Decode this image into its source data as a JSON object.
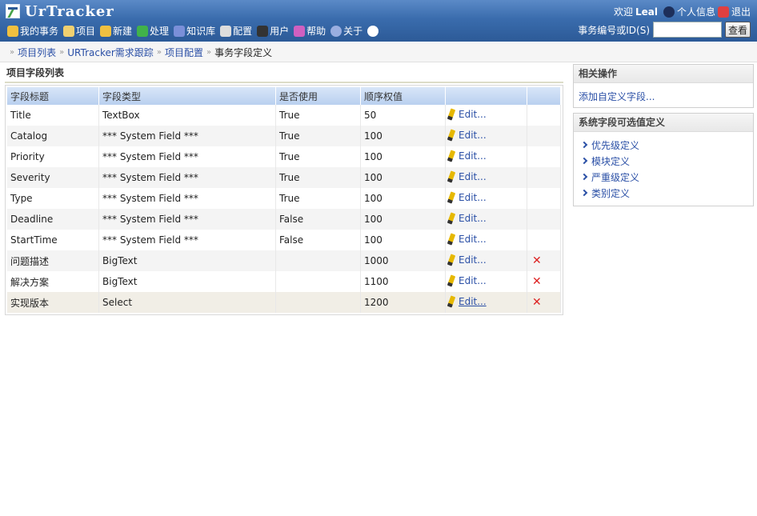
{
  "app": {
    "logo_text": "UrTracker"
  },
  "user": {
    "welcome": "欢迎",
    "name": "Leal",
    "profile_label": "个人信息",
    "logout_label": "退出"
  },
  "menu": [
    {
      "label": "我的事务",
      "icon": "home-icon",
      "color": "#f0c040"
    },
    {
      "label": "项目",
      "icon": "project-icon",
      "color": "#f0d070"
    },
    {
      "label": "新建",
      "icon": "new-icon",
      "color": "#f0c040"
    },
    {
      "label": "处理",
      "icon": "check-icon",
      "color": "#41b24a"
    },
    {
      "label": "知识库",
      "icon": "book-icon",
      "color": "#7a8fd8"
    },
    {
      "label": "配置",
      "icon": "config-icon",
      "color": "#dddddd"
    },
    {
      "label": "用户",
      "icon": "user-icon",
      "color": "#333333"
    },
    {
      "label": "帮助",
      "icon": "help-icon",
      "color": "#d060c0"
    },
    {
      "label": "关于",
      "icon": "about-icon",
      "color": "#9aaee0"
    },
    {
      "label": "",
      "icon": "info-icon",
      "color": "#ffffff"
    }
  ],
  "search": {
    "label": "事务编号或ID(S)",
    "value": "",
    "button": "查看"
  },
  "breadcrumb": [
    {
      "label": "项目列表",
      "link": true
    },
    {
      "label": "URTracker需求跟踪",
      "link": true
    },
    {
      "label": "项目配置",
      "link": true
    },
    {
      "label": "事务字段定义",
      "link": false
    }
  ],
  "main": {
    "title": "项目字段列表",
    "columns": [
      "字段标题",
      "字段类型",
      "是否使用",
      "顺序权值",
      "",
      ""
    ],
    "rows": [
      {
        "title": "Title",
        "type": "TextBox",
        "used": "True",
        "order": "50",
        "edit": "Edit...",
        "deletable": false
      },
      {
        "title": "Catalog",
        "type": "*** System Field ***",
        "used": "True",
        "order": "100",
        "edit": "Edit...",
        "deletable": false
      },
      {
        "title": "Priority",
        "type": "*** System Field ***",
        "used": "True",
        "order": "100",
        "edit": "Edit...",
        "deletable": false
      },
      {
        "title": "Severity",
        "type": "*** System Field ***",
        "used": "True",
        "order": "100",
        "edit": "Edit...",
        "deletable": false
      },
      {
        "title": "Type",
        "type": "*** System Field ***",
        "used": "True",
        "order": "100",
        "edit": "Edit...",
        "deletable": false
      },
      {
        "title": "Deadline",
        "type": "*** System Field ***",
        "used": "False",
        "order": "100",
        "edit": "Edit...",
        "deletable": false
      },
      {
        "title": "StartTime",
        "type": "*** System Field ***",
        "used": "False",
        "order": "100",
        "edit": "Edit...",
        "deletable": false
      },
      {
        "title": "问题描述",
        "type": "BigText",
        "used": "",
        "order": "1000",
        "edit": "Edit...",
        "deletable": true
      },
      {
        "title": "解决方案",
        "type": "BigText",
        "used": "",
        "order": "1100",
        "edit": "Edit...",
        "deletable": true
      },
      {
        "title": "实现版本",
        "type": "Select",
        "used": "",
        "order": "1200",
        "edit": "Edit...",
        "deletable": true
      }
    ]
  },
  "sidebar": {
    "actions": {
      "title": "相关操作",
      "links": [
        "添加自定义字段..."
      ]
    },
    "system_fields": {
      "title": "系统字段可选值定义",
      "links": [
        "优先级定义",
        "模块定义",
        "严重级定义",
        "类别定义"
      ]
    }
  },
  "colors": {
    "header": "#3a6cad",
    "link": "#2a4fa6",
    "delete": "#dd2222",
    "table_header": "#c6daf3"
  }
}
